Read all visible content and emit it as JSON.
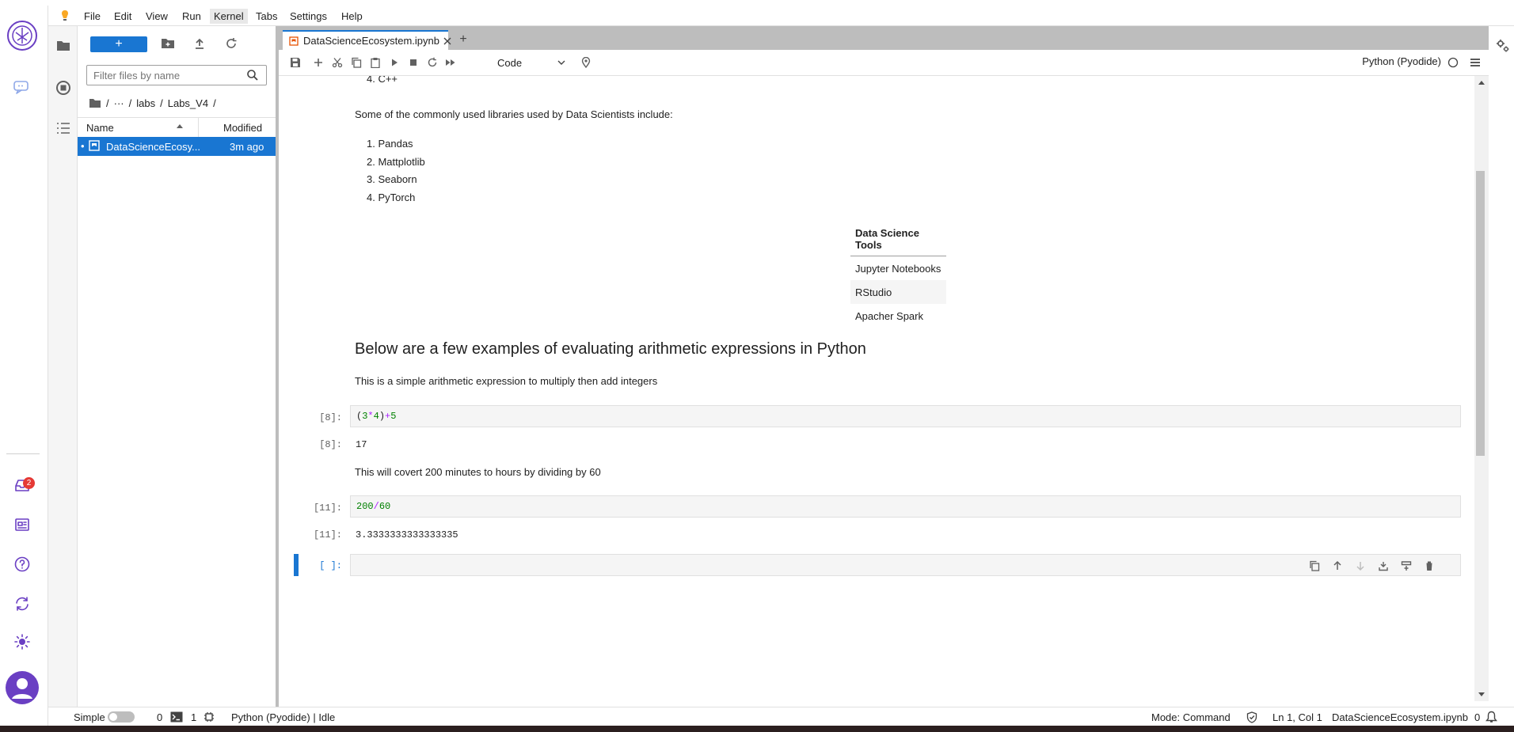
{
  "menu": [
    "File",
    "Edit",
    "View",
    "Run",
    "Kernel",
    "Tabs",
    "Settings",
    "Help"
  ],
  "menu_active": "Kernel",
  "rail": {
    "badge_count": "2"
  },
  "filebrowser": {
    "new_label": "+",
    "filter_placeholder": "Filter files by name",
    "breadcrumb": {
      "sep1": "/",
      "ellipsis": "···",
      "sep2": "/",
      "dir1": "labs",
      "sep3": "/",
      "dir2": "Labs_V4",
      "sep4": "/"
    },
    "col_name": "Name",
    "col_modified": "Modified",
    "files": [
      {
        "bullet": "•",
        "name": "DataScienceEcosy...",
        "modified": "3m ago"
      }
    ]
  },
  "tab": {
    "title": "DataScienceEcosystem.ipynb",
    "add_label": "+"
  },
  "toolbar": {
    "cell_type": "Code",
    "kernel": "Python (Pyodide)"
  },
  "notebook": {
    "list_top_item": "4.  C++",
    "libs_intro": "Some of the commonly used libraries used by Data Scientists include:",
    "libs": [
      "1.  Pandas",
      "2.  Mattplotlib",
      "3.  Seaborn",
      "4.  PyTorch"
    ],
    "table": {
      "header": "Data Science Tools",
      "rows": [
        "Jupyter Notebooks",
        "RStudio",
        "Apacher Spark"
      ]
    },
    "heading": "Below are a few examples of evaluating arithmetic expressions in Python",
    "md1": "This is a simple arithmetic expression to multiply then add integers",
    "cell1": {
      "in_prompt": "[8]:",
      "out_prompt": "[8]:",
      "code_open": "(",
      "code_a": "3",
      "code_op1": "*",
      "code_b": "4",
      "code_close": ")",
      "code_op2": "+",
      "code_c": "5",
      "output": "17"
    },
    "md2": "This will covert 200 minutes to hours by dividing by 60",
    "cell2": {
      "in_prompt": "[11]:",
      "out_prompt": "[11]:",
      "code_a": "200",
      "code_op": "/",
      "code_b": "60",
      "output": "3.3333333333333335"
    },
    "cell3": {
      "in_prompt": "[ ]:"
    }
  },
  "status": {
    "simple": "Simple",
    "terminals": "0",
    "kernels": "1",
    "kernel_state": "Python (Pyodide) | Idle",
    "mode": "Mode: Command",
    "position": "Ln 1, Col 1",
    "file": "DataScienceEcosystem.ipynb",
    "notifications": "0"
  },
  "colors": {
    "accent": "#1976d2",
    "rail_icon": "#6a3fc3",
    "badge": "#e53935",
    "number": "#008000",
    "operator": "#aa22ff"
  }
}
